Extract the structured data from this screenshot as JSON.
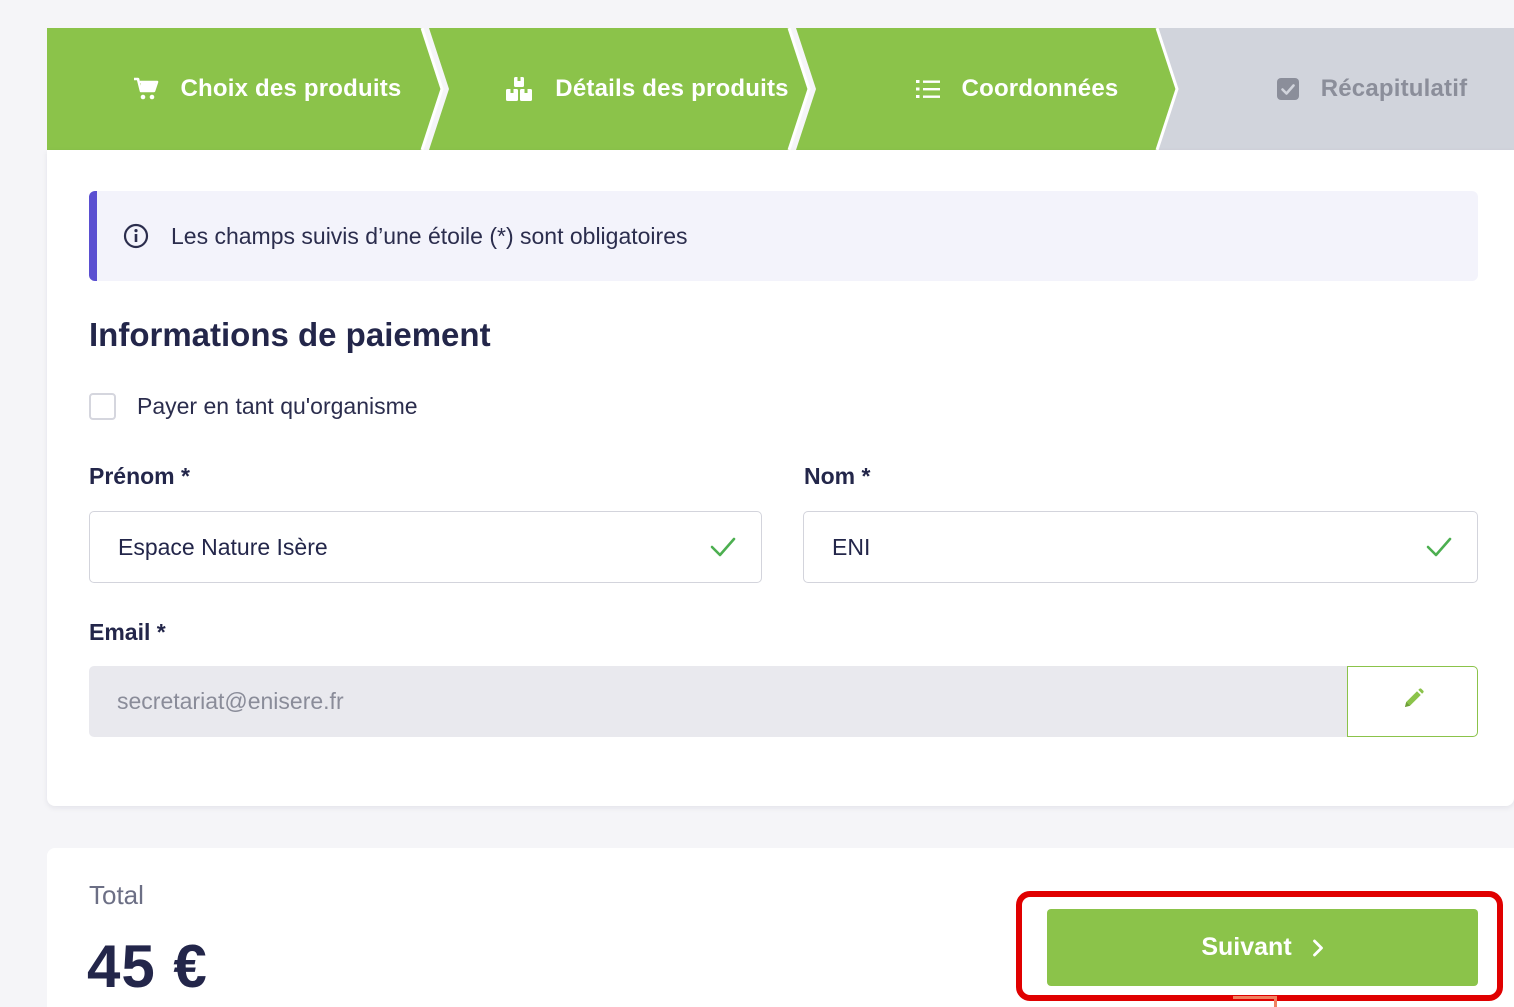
{
  "colors": {
    "step_active": "#8bc34a",
    "step_inactive": "#d1d4dc",
    "accent": "#5a4fd1",
    "highlight": "#e00000"
  },
  "stepper": {
    "steps": [
      {
        "label": "Choix des produits",
        "icon": "cart-icon",
        "state": "completed"
      },
      {
        "label": "Détails des produits",
        "icon": "boxes-icon",
        "state": "completed"
      },
      {
        "label": "Coordonnées",
        "icon": "list-icon",
        "state": "active"
      },
      {
        "label": "Récapitulatif",
        "icon": "check-square-icon",
        "state": "pending"
      }
    ]
  },
  "notice": {
    "icon": "info-icon",
    "text": "Les champs suivis d’une étoile (*) sont obligatoires"
  },
  "payment": {
    "title": "Informations de paiement",
    "organism_checkbox_label": "Payer en tant qu'organisme",
    "organism_checked": false,
    "first_name_label": "Prénom *",
    "first_name_value": "Espace Nature Isère",
    "last_name_label": "Nom *",
    "last_name_value": "ENI",
    "email_label": "Email *",
    "email_value": "secretariat@enisere.fr",
    "email_edit_icon": "pencil-icon"
  },
  "summary": {
    "total_label": "Total",
    "total_value": "45 €",
    "next_button_label": "Suivant",
    "next_icon": "chevron-right-icon"
  }
}
